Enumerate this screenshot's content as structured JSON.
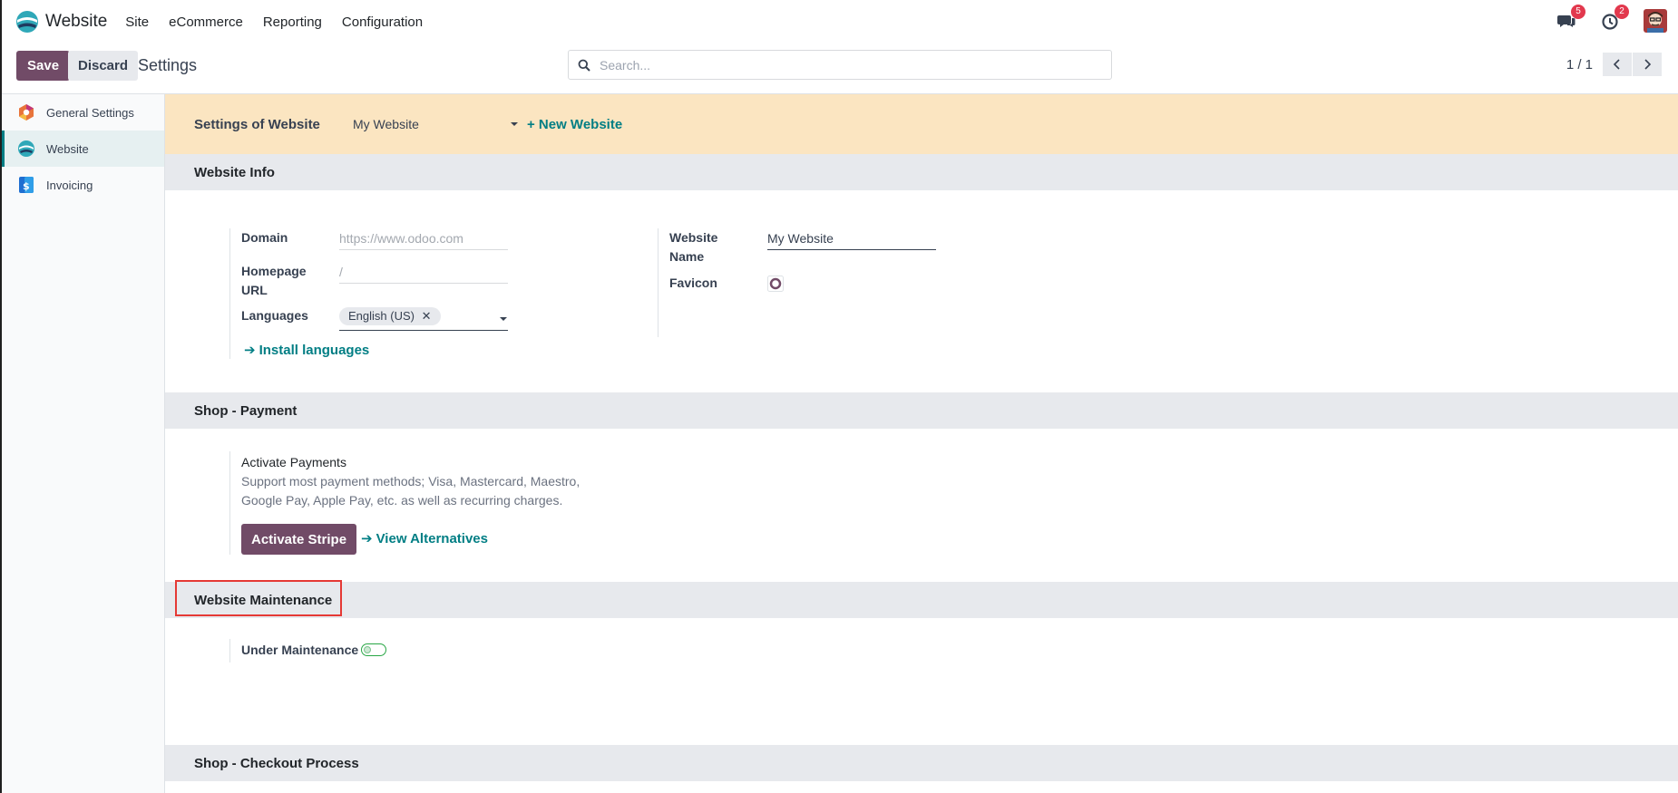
{
  "app": {
    "name": "Website",
    "menu": [
      "Site",
      "eCommerce",
      "Reporting",
      "Configuration"
    ],
    "chat_badge": "5",
    "activity_badge": "2"
  },
  "control_panel": {
    "save_label": "Save",
    "discard_label": "Discard",
    "title": "Settings",
    "search_placeholder": "Search...",
    "pager": "1 / 1"
  },
  "sidebar": {
    "items": [
      {
        "label": "General Settings",
        "icon": "settings-app-icon"
      },
      {
        "label": "Website",
        "icon": "website-app-icon"
      },
      {
        "label": "Invoicing",
        "icon": "invoicing-app-icon"
      }
    ]
  },
  "website_bar": {
    "label": "Settings of Website",
    "selected": "My Website",
    "new_website": "+ New Website"
  },
  "website_info": {
    "title": "Website Info",
    "domain_label": "Domain",
    "domain_placeholder": "https://www.odoo.com",
    "homepage_label_1": "Homepage",
    "homepage_label_2": "URL",
    "homepage_placeholder": "/",
    "languages_label": "Languages",
    "language_tag": "English (US)",
    "install_languages": "Install languages",
    "website_name_label_1": "Website",
    "website_name_label_2": "Name",
    "website_name_value": "My Website",
    "favicon_label": "Favicon"
  },
  "shop_payment": {
    "title": "Shop - Payment",
    "heading": "Activate Payments",
    "desc_line_1": "Support most payment methods; Visa, Mastercard, Maestro,",
    "desc_line_2": "Google Pay, Apple Pay, etc. as well as recurring charges.",
    "activate_stripe": "Activate Stripe",
    "view_alternatives": "View Alternatives"
  },
  "website_maintenance": {
    "title": "Website Maintenance",
    "under_maintenance_label": "Under Maintenance",
    "under_maintenance": false
  },
  "shop_checkout": {
    "title": "Shop - Checkout Process"
  },
  "colors": {
    "primary": "#714b67",
    "link": "#017e84",
    "banner": "#fbe5c1",
    "section": "#e7e9ed",
    "highlight": "#e53935"
  }
}
